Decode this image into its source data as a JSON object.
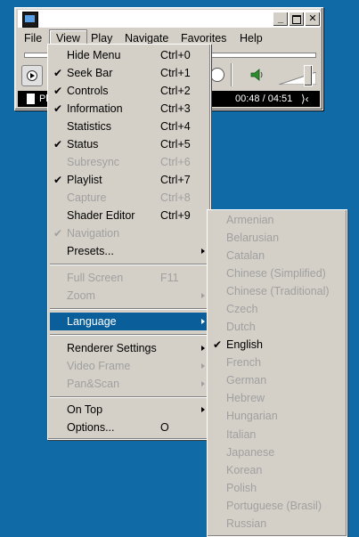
{
  "menubar": {
    "items": [
      "File",
      "View",
      "Play",
      "Navigate",
      "Favorites",
      "Help"
    ]
  },
  "player": {
    "status_text": "Pl",
    "time": "00:48 / 04:51"
  },
  "view_menu": {
    "items": [
      {
        "label": "Hide Menu",
        "shortcut": "Ctrl+0",
        "checked": false,
        "disabled": false
      },
      {
        "label": "Seek Bar",
        "shortcut": "Ctrl+1",
        "checked": true,
        "disabled": false
      },
      {
        "label": "Controls",
        "shortcut": "Ctrl+2",
        "checked": true,
        "disabled": false
      },
      {
        "label": "Information",
        "shortcut": "Ctrl+3",
        "checked": true,
        "disabled": false
      },
      {
        "label": "Statistics",
        "shortcut": "Ctrl+4",
        "checked": false,
        "disabled": false
      },
      {
        "label": "Status",
        "shortcut": "Ctrl+5",
        "checked": true,
        "disabled": false
      },
      {
        "label": "Subresync",
        "shortcut": "Ctrl+6",
        "checked": false,
        "disabled": true
      },
      {
        "label": "Playlist",
        "shortcut": "Ctrl+7",
        "checked": true,
        "disabled": false
      },
      {
        "label": "Capture",
        "shortcut": "Ctrl+8",
        "checked": false,
        "disabled": true
      },
      {
        "label": "Shader Editor",
        "shortcut": "Ctrl+9",
        "checked": false,
        "disabled": false
      },
      {
        "label": "Navigation",
        "shortcut": "",
        "checked": true,
        "disabled": true
      },
      {
        "label": "Presets...",
        "shortcut": "",
        "submenu": true,
        "disabled": false
      },
      {
        "label": "Full Screen",
        "shortcut": "F11",
        "disabled": true
      },
      {
        "label": "Zoom",
        "shortcut": "",
        "submenu": true,
        "disabled": true
      },
      {
        "label": "Language",
        "submenu": true,
        "highlighted": true
      },
      {
        "label": "Renderer Settings",
        "submenu": true,
        "disabled": false
      },
      {
        "label": "Video Frame",
        "submenu": true,
        "disabled": true
      },
      {
        "label": "Pan&Scan",
        "submenu": true,
        "disabled": true
      },
      {
        "label": "On Top",
        "submenu": true,
        "disabled": false
      },
      {
        "label": "Options...",
        "shortcut": "O",
        "disabled": false
      }
    ]
  },
  "language_menu": {
    "items": [
      {
        "label": "Armenian",
        "checked": false,
        "disabled": true
      },
      {
        "label": "Belarusian",
        "checked": false,
        "disabled": true
      },
      {
        "label": "Catalan",
        "checked": false,
        "disabled": true
      },
      {
        "label": "Chinese (Simplified)",
        "checked": false,
        "disabled": true
      },
      {
        "label": "Chinese (Traditional)",
        "checked": false,
        "disabled": true
      },
      {
        "label": "Czech",
        "checked": false,
        "disabled": true
      },
      {
        "label": "Dutch",
        "checked": false,
        "disabled": true
      },
      {
        "label": "English",
        "checked": true,
        "disabled": false
      },
      {
        "label": "French",
        "checked": false,
        "disabled": true
      },
      {
        "label": "German",
        "checked": false,
        "disabled": true
      },
      {
        "label": "Hebrew",
        "checked": false,
        "disabled": true
      },
      {
        "label": "Hungarian",
        "checked": false,
        "disabled": true
      },
      {
        "label": "Italian",
        "checked": false,
        "disabled": true
      },
      {
        "label": "Japanese",
        "checked": false,
        "disabled": true
      },
      {
        "label": "Korean",
        "checked": false,
        "disabled": true
      },
      {
        "label": "Polish",
        "checked": false,
        "disabled": true
      },
      {
        "label": "Portuguese (Brasil)",
        "checked": false,
        "disabled": true
      },
      {
        "label": "Russian",
        "checked": false,
        "disabled": true
      }
    ]
  },
  "colors": {
    "desktop": "#0f6aa5",
    "menu_bg": "#d4d0c8",
    "highlight": "#0a5f9a",
    "disabled_text": "#a0a0a0"
  }
}
